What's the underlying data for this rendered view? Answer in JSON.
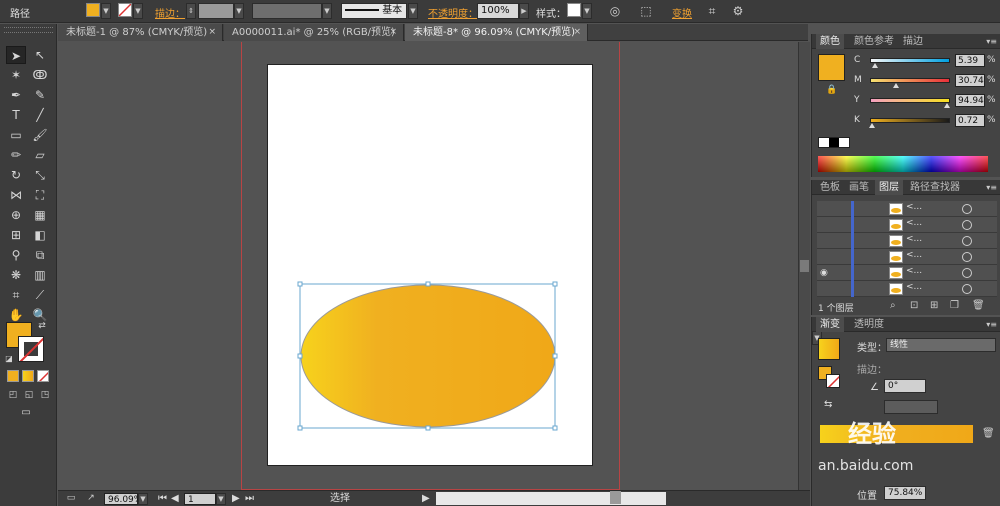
{
  "control_bar": {
    "object_type": "路径",
    "fill_color": "#f0b020",
    "stroke_label": "描边：",
    "stroke_style": "基本",
    "opacity_label": "不透明度：",
    "opacity_value": "100%",
    "style_label": "样式：",
    "transform_label": "变换"
  },
  "tabs": [
    {
      "label": "未标题-1 @ 87% (CMYK/预览)",
      "close": "×"
    },
    {
      "label": "A0000011.ai* @ 25% (RGB/预览)",
      "close": "×"
    },
    {
      "label": "未标题-8* @ 96.09% (CMYK/预览)",
      "close": "×"
    }
  ],
  "ellipse": {
    "gradient_start": "#f7d21c",
    "gradient_mid": "#f0b020",
    "gradient_end": "#f0a818"
  },
  "status_bar": {
    "zoom": "96.09%",
    "artboard_number": "1",
    "tool_status": "选择"
  },
  "color_panel": {
    "tabs": [
      "颜色",
      "颜色参考",
      "描边"
    ],
    "swatch": "#f0b020",
    "channels": [
      {
        "label": "C",
        "value": "5.39",
        "unit": "%",
        "fraction": 0.054
      },
      {
        "label": "M",
        "value": "30.74",
        "unit": "%",
        "fraction": 0.307
      },
      {
        "label": "Y",
        "value": "94.94",
        "unit": "%",
        "fraction": 0.949
      },
      {
        "label": "K",
        "value": "0.72",
        "unit": "%",
        "fraction": 0.007
      }
    ]
  },
  "layers_panel": {
    "tabs": [
      "色板",
      "画笔",
      "图层",
      "路径查找器"
    ],
    "rows": [
      {
        "name": "<..."
      },
      {
        "name": "<..."
      },
      {
        "name": "<..."
      },
      {
        "name": "<..."
      },
      {
        "name": "<..."
      },
      {
        "name": "<..."
      }
    ],
    "footer": "1 个图层"
  },
  "gradient_panel": {
    "tabs": [
      "渐变",
      "透明度"
    ],
    "type_label": "类型：",
    "type_value": "线性",
    "stroke_label": "描边：",
    "angle_value": "0°",
    "position_label": "位置",
    "position_value": "75.84%"
  },
  "watermark": {
    "line1": "经验",
    "line2": "an.baidu.com"
  }
}
